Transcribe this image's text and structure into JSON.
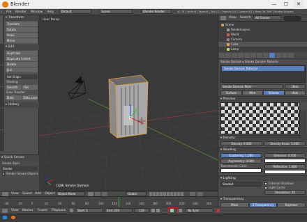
{
  "window": {
    "title": "Blender",
    "minimize": "—",
    "maximize": "☐",
    "close": "✕"
  },
  "menubar": {
    "info_icon": "i",
    "items": [
      "File",
      "Render",
      "Window",
      "Help"
    ],
    "layout": "Default",
    "scene": "Scene",
    "engine": "Blender Render",
    "stats": "v2.78 | Verts:8 | Faces:6 | Tris:12 | Objects:1/4 | Lamps:0/1 | Mem:26.34M | Smoke Domain"
  },
  "toolshelf": {
    "vertical_tabs": [
      "Tools",
      "Create",
      "Relations",
      "Animation",
      "Physics",
      "Grease Pencil"
    ],
    "transform": {
      "header": "Transform",
      "buttons": [
        "Translate",
        "Rotate",
        "Scale",
        "Mirror"
      ]
    },
    "edit": {
      "header": "Edit",
      "buttons": [
        "Duplicate",
        "Duplicate Linked",
        "Delete",
        "Join"
      ],
      "set_origin": "Set Origin"
    },
    "shading": {
      "label": "Shading:",
      "smooth": "Smooth",
      "flat": "Flat"
    },
    "data_transfer": {
      "label": "Data Transfer:",
      "data": "Data",
      "data_layo": "Data Layo"
    },
    "history": "History",
    "operator": {
      "header": "Quick Smoke",
      "style_label": "Smoke Style:",
      "style_value": "Smoke",
      "render_objects": "Render Smoke Objects"
    }
  },
  "viewport": {
    "label": "User Persp",
    "object_label": "(128) Smoke Domain"
  },
  "view3d_header": {
    "menus": [
      "View",
      "Select",
      "Add",
      "Object"
    ],
    "mode": "Object Mode",
    "orientation": "Global"
  },
  "timeline": {
    "ticks": [
      "-40",
      "-20",
      "0",
      "20",
      "40",
      "60",
      "80",
      "100",
      "120",
      "140",
      "160",
      "180",
      "200",
      "220",
      "240",
      "260"
    ]
  },
  "timeline_header": {
    "menus": [
      "View",
      "Marker",
      "Frame",
      "Playback"
    ],
    "start_label": "Start:",
    "start_value": "1",
    "end_label": "End:",
    "end_value": "250",
    "current_frame": "128",
    "sync": "No Sync"
  },
  "outliner": {
    "header_menus": [
      "View",
      "Search"
    ],
    "filter": "All Scenes",
    "rows": [
      {
        "name": "Scene",
        "indent": 0,
        "color": "#c8a160"
      },
      {
        "name": "RenderLayers",
        "indent": 1,
        "color": "#9aa0aa"
      },
      {
        "name": "World",
        "indent": 1,
        "color": "#d06060"
      },
      {
        "name": "Camera",
        "indent": 1,
        "color": "#8a8a8a"
      },
      {
        "name": "Cube",
        "indent": 1,
        "color": "#e0a050"
      },
      {
        "name": "Lamp",
        "indent": 1,
        "color": "#d0d060"
      }
    ]
  },
  "properties": {
    "breadcrumb": [
      "Smoke Domain",
      "Smoke Domain Material"
    ],
    "material_slot": "Smoke Domain Material",
    "material_field": "Smoke Domain Mate",
    "data_label": "Data",
    "material_types": [
      "Surface",
      "Wire",
      "Volume",
      "Halo"
    ],
    "active_type": "Volume",
    "preview_header": "Preview",
    "density": {
      "header": "Density",
      "density_label": "Density:",
      "density_value": "0.000",
      "scale_label": "Density Scale:",
      "scale_value": "5.000"
    },
    "shading": {
      "header": "Shading",
      "scattering_label": "Scattering:",
      "scattering_value": "1.000",
      "asymmetry_label": "Asymmetry:",
      "asymmetry_value": "0.000",
      "transmission_label": "Transmission Color:",
      "emission_label": "Emission:",
      "emission_value": "0.000",
      "reflection_label": "Reflection:",
      "reflection_value": "1.000"
    },
    "lighting": {
      "header": "Lighting",
      "mode": "Shaded",
      "external_shadows": "External Shadows",
      "light_cache": "Light Cache",
      "resolution_label": "Resolution:",
      "resolution_value": "50"
    },
    "transparency": {
      "header": "Transparency",
      "options": [
        "Mask",
        "Z Transparency",
        "Raytrace"
      ],
      "active": "Z Transparency"
    }
  },
  "colors": {
    "selection": "#e8a030",
    "highlight": "#e02020",
    "accent": "#5680c2"
  }
}
